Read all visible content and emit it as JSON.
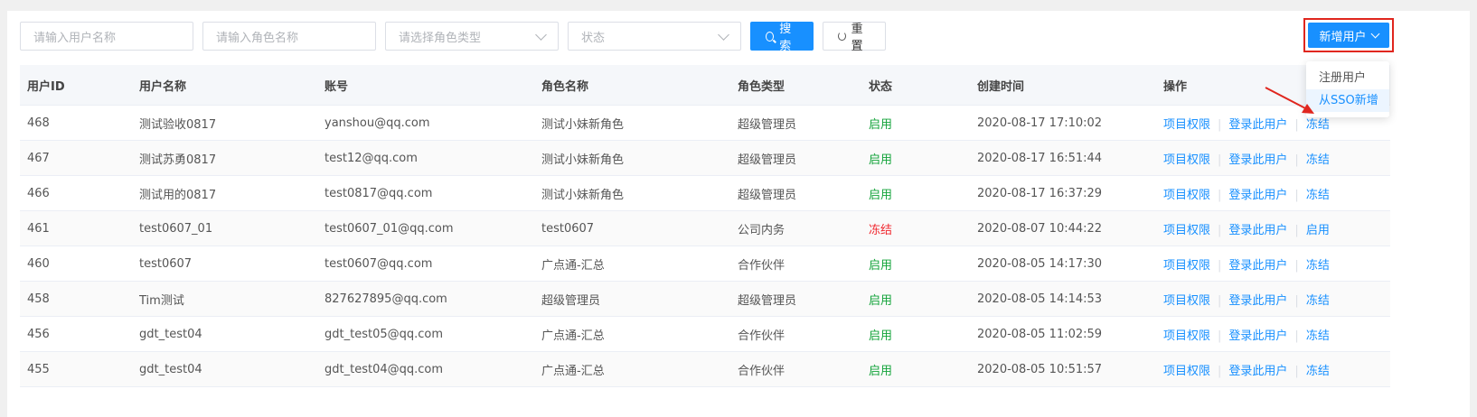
{
  "filters": {
    "username_placeholder": "请输入用户名称",
    "rolename_placeholder": "请输入角色名称",
    "roletype_placeholder": "请选择角色类型",
    "status_placeholder": "状态",
    "search_label": "搜索",
    "reset_label": "重置",
    "add_label": "新增用户"
  },
  "dropdown": {
    "items": [
      "注册用户",
      "从SSO新增"
    ]
  },
  "table": {
    "headers": [
      "用户ID",
      "用户名称",
      "账号",
      "角色名称",
      "角色类型",
      "状态",
      "创建时间",
      "操作"
    ],
    "rows": [
      {
        "id": "468",
        "name": "测试验收0817",
        "account": "yanshou@qq.com",
        "role": "测试小妹新角色",
        "type": "超级管理员",
        "status": "启用",
        "created": "2020-08-17 17:10:02",
        "op1": "项目权限",
        "op2": "登录此用户",
        "op3": "冻结"
      },
      {
        "id": "467",
        "name": "测试苏勇0817",
        "account": "test12@qq.com",
        "role": "测试小妹新角色",
        "type": "超级管理员",
        "status": "启用",
        "created": "2020-08-17 16:51:44",
        "op1": "项目权限",
        "op2": "登录此用户",
        "op3": "冻结"
      },
      {
        "id": "466",
        "name": "测试用的0817",
        "account": "test0817@qq.com",
        "role": "测试小妹新角色",
        "type": "超级管理员",
        "status": "启用",
        "created": "2020-08-17 16:37:29",
        "op1": "项目权限",
        "op2": "登录此用户",
        "op3": "冻结"
      },
      {
        "id": "461",
        "name": "test0607_01",
        "account": "test0607_01@qq.com",
        "role": "test0607",
        "type": "公司内务",
        "status": "冻结",
        "created": "2020-08-07 10:44:22",
        "op1": "项目权限",
        "op2": "登录此用户",
        "op3": "启用"
      },
      {
        "id": "460",
        "name": "test0607",
        "account": "test0607@qq.com",
        "role": "广点通-汇总",
        "type": "合作伙伴",
        "status": "启用",
        "created": "2020-08-05 14:17:30",
        "op1": "项目权限",
        "op2": "登录此用户",
        "op3": "冻结"
      },
      {
        "id": "458",
        "name": "Tim测试",
        "account": "827627895@qq.com",
        "role": "超级管理员",
        "type": "超级管理员",
        "status": "启用",
        "created": "2020-08-05 14:14:53",
        "op1": "项目权限",
        "op2": "登录此用户",
        "op3": "冻结"
      },
      {
        "id": "456",
        "name": "gdt_test04",
        "account": "gdt_test05@qq.com",
        "role": "广点通-汇总",
        "type": "合作伙伴",
        "status": "启用",
        "created": "2020-08-05 11:02:59",
        "op1": "项目权限",
        "op2": "登录此用户",
        "op3": "冻结"
      },
      {
        "id": "455",
        "name": "gdt_test04",
        "account": "gdt_test04@qq.com",
        "role": "广点通-汇总",
        "type": "合作伙伴",
        "status": "启用",
        "created": "2020-08-05 10:51:57",
        "op1": "项目权限",
        "op2": "登录此用户",
        "op3": "冻结"
      }
    ]
  },
  "colors": {
    "primary": "#1890ff",
    "enabled": "#13a33a",
    "frozen": "#f0262d",
    "highlight": "#e0261e"
  }
}
